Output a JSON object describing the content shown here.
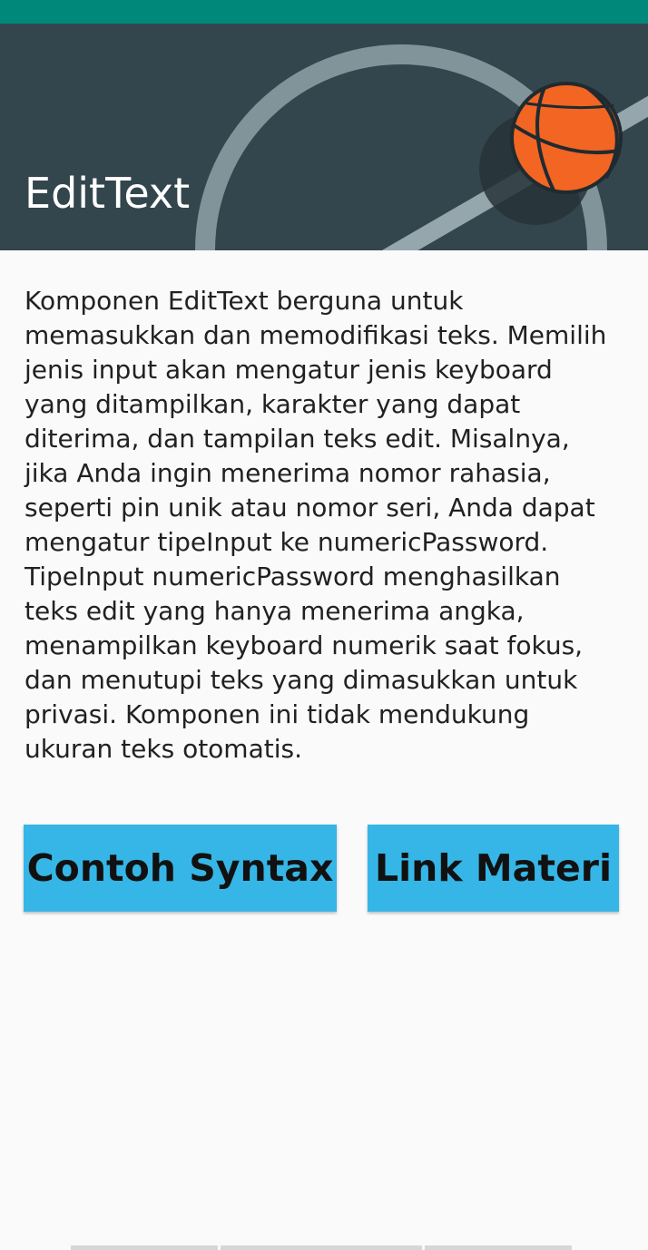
{
  "app": {
    "title": "EditText"
  },
  "content": {
    "description": "Komponen EditText berguna untuk\nmemasukkan dan memodifikasi teks. Memilih\njenis input akan mengatur jenis keyboard\nyang ditampilkan, karakter yang dapat\nditerima, dan tampilan teks edit. Misalnya,\njika Anda ingin menerima nomor rahasia,\nseperti pin unik atau nomor seri, Anda dapat\nmengatur tipeInput ke numericPassword.\nTipeInput numericPassword menghasilkan\nteks edit yang hanya menerima angka,\nmenampilkan keyboard numerik saat fokus,\ndan menutupi teks yang dimasukkan untuk\nprivasi. Komponen ini tidak mendukung\nukuran teks otomatis."
  },
  "buttons": {
    "syntax_label": "Contoh Syntax",
    "materi_label": "Link Materi"
  },
  "icons": {
    "header_image": "basketball-court-illustration"
  },
  "colors": {
    "status_bar": "#00897b",
    "header_bg": "#34464d",
    "button_bg": "#35b6e6",
    "ball": "#f26522"
  }
}
